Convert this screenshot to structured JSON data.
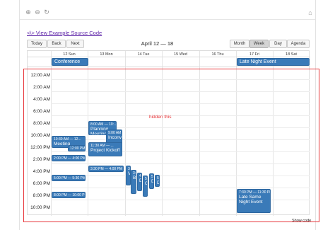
{
  "toolbar": {
    "icons": [
      "zoom-in-icon",
      "zoom-out-icon",
      "reset-icon",
      "home-icon"
    ],
    "zoom_in": "⊕",
    "zoom_out": "⊖",
    "reset": "↻",
    "home": "⌂"
  },
  "source_link": "<\\> View Example Source Code",
  "nav": {
    "today": "Today",
    "back": "Back",
    "next": "Next",
    "range": "April 12 — 18",
    "views": [
      "Month",
      "Week",
      "Day",
      "Agenda"
    ],
    "active_view": "Week"
  },
  "days": [
    "12 Sun",
    "13 Mon",
    "14 Tue",
    "15 Wed",
    "16 Thu",
    "17 Fri",
    "18 Sat"
  ],
  "times": [
    "12:00 AM",
    "2:00 AM",
    "4:00 AM",
    "6:00 AM",
    "8:00 AM",
    "10:00 AM",
    "12:00 PM",
    "2:00 PM",
    "4:00 PM",
    "6:00 PM",
    "8:00 PM",
    "10:00 PM"
  ],
  "allday_events": [
    {
      "title": "Conference"
    },
    {
      "title": "Late Night Event"
    }
  ],
  "events": [
    {
      "time": "8:00 AM — 10:...",
      "title": "Planning Meeting"
    },
    {
      "time": "9:00 AM — ...",
      "title": "Inconvenient"
    },
    {
      "time": "10:30 AM — 12...",
      "title": "Meeting"
    },
    {
      "time": "11:30 AM — ...",
      "title": "Project Kickoff"
    },
    {
      "time": "12:00 PM —",
      "title": ""
    },
    {
      "time": "2:00 PM — 4:00 PM",
      "title": ""
    },
    {
      "time": "3:30 PM — 4:00 PM",
      "title": ""
    },
    {
      "time": "5:00 PM — 5:30 PM",
      "title": ""
    },
    {
      "time": "8:00 PM — 10:00 PM",
      "title": ""
    },
    {
      "time": "7:30 PM — 11:30 PM",
      "title": "Late Same Night Event"
    },
    {
      "time": "3:",
      "title": "V"
    },
    {
      "time": "3:",
      "title": "B"
    },
    {
      "time": "4:",
      "title": "D"
    },
    {
      "time": "5:",
      "title": "O"
    },
    {
      "time": "5:",
      "title": "D"
    },
    {
      "time": "5:",
      "title": "D"
    }
  ],
  "hidden_label": "hidden this",
  "show_code": "Show code",
  "colors": {
    "event": "#3a7ab8",
    "outline": "#e8373b",
    "link": "#5a1fa6"
  }
}
